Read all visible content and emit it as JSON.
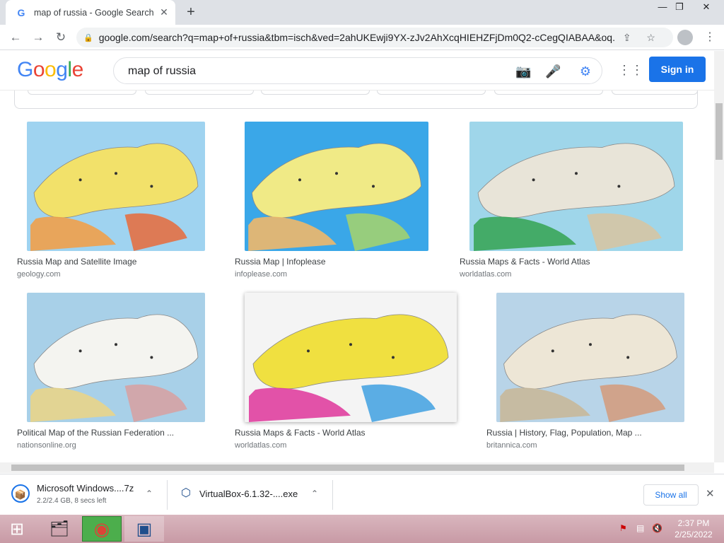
{
  "browser": {
    "tab_title": "map of russia - Google Search",
    "tab_favicon": "G",
    "close_tab": "✕",
    "new_tab": "+",
    "window_min": "—",
    "window_max": "❐",
    "window_close": "✕",
    "back": "←",
    "forward": "→",
    "reload": "↻",
    "lock": "🔒",
    "url": "google.com/search?q=map+of+russia&tbm=isch&ved=2ahUKEwji9YX-zJv2AhXcqHIEHZFjDm0Q2-cCegQIABAA&oq...",
    "share": "⇪",
    "bookmark": "☆",
    "menu": "⋮"
  },
  "google": {
    "logo_letters": [
      {
        "ch": "G",
        "color": "#4285F4"
      },
      {
        "ch": "o",
        "color": "#EA4335"
      },
      {
        "ch": "o",
        "color": "#FBBC05"
      },
      {
        "ch": "g",
        "color": "#4285F4"
      },
      {
        "ch": "l",
        "color": "#34A853"
      },
      {
        "ch": "e",
        "color": "#EA4335"
      }
    ],
    "query": "map of russia",
    "camera_icon": "📷",
    "mic_icon": "🎤",
    "lens_icon": "⚙",
    "apps_icon": "⋮⋮",
    "sign_in": "Sign in"
  },
  "results": [
    {
      "title": "Russia Map and Satellite Image",
      "source": "geology.com",
      "palette": [
        "#9fd3f0",
        "#f2e16a",
        "#f0a04a",
        "#e86a3a"
      ]
    },
    {
      "title": "Russia Map | Infoplease",
      "source": "infoplease.com",
      "palette": [
        "#3aa7e8",
        "#f0ea86",
        "#f0b86a",
        "#a8d46a"
      ]
    },
    {
      "title": "Russia Maps & Facts - World Atlas",
      "source": "worldatlas.com",
      "palette": [
        "#9fd6ea",
        "#e8e4d8",
        "#3aa65a",
        "#d8c4a0"
      ]
    },
    {
      "title": "Political Map of the Russian Federation ...",
      "source": "nationsonline.org",
      "palette": [
        "#a8d0e8",
        "#f4f4f0",
        "#e8d48a",
        "#d8a0a0"
      ]
    },
    {
      "title": "Russia Maps & Facts - World Atlas",
      "source": "worldatlas.com",
      "palette": [
        "#f4f4f4",
        "#f0e040",
        "#e040a0",
        "#40a0e0"
      ]
    },
    {
      "title": "Russia | History, Flag, Population, Map ...",
      "source": "britannica.com",
      "palette": [
        "#b8d4e8",
        "#ede6d6",
        "#c8b89a",
        "#d49a7a"
      ]
    }
  ],
  "downloads": [
    {
      "name": "Microsoft Windows....7z",
      "status": "2.2/2.4 GB, 8 secs left",
      "icon": "📦"
    },
    {
      "name": "VirtualBox-6.1.32-....exe",
      "status": "",
      "icon": "⬡"
    }
  ],
  "download_chevron": "⌃",
  "show_all": "Show all",
  "downloads_close": "✕",
  "taskbar": {
    "start_icon": "⊞",
    "explorer_icon": "🗂",
    "chrome_icon": "◉",
    "vbox_icon": "▣",
    "time": "2:37 PM",
    "date": "2/25/2022",
    "flag_icon": "⚑",
    "network_icon": "▤",
    "volume_icon": "🔇"
  }
}
